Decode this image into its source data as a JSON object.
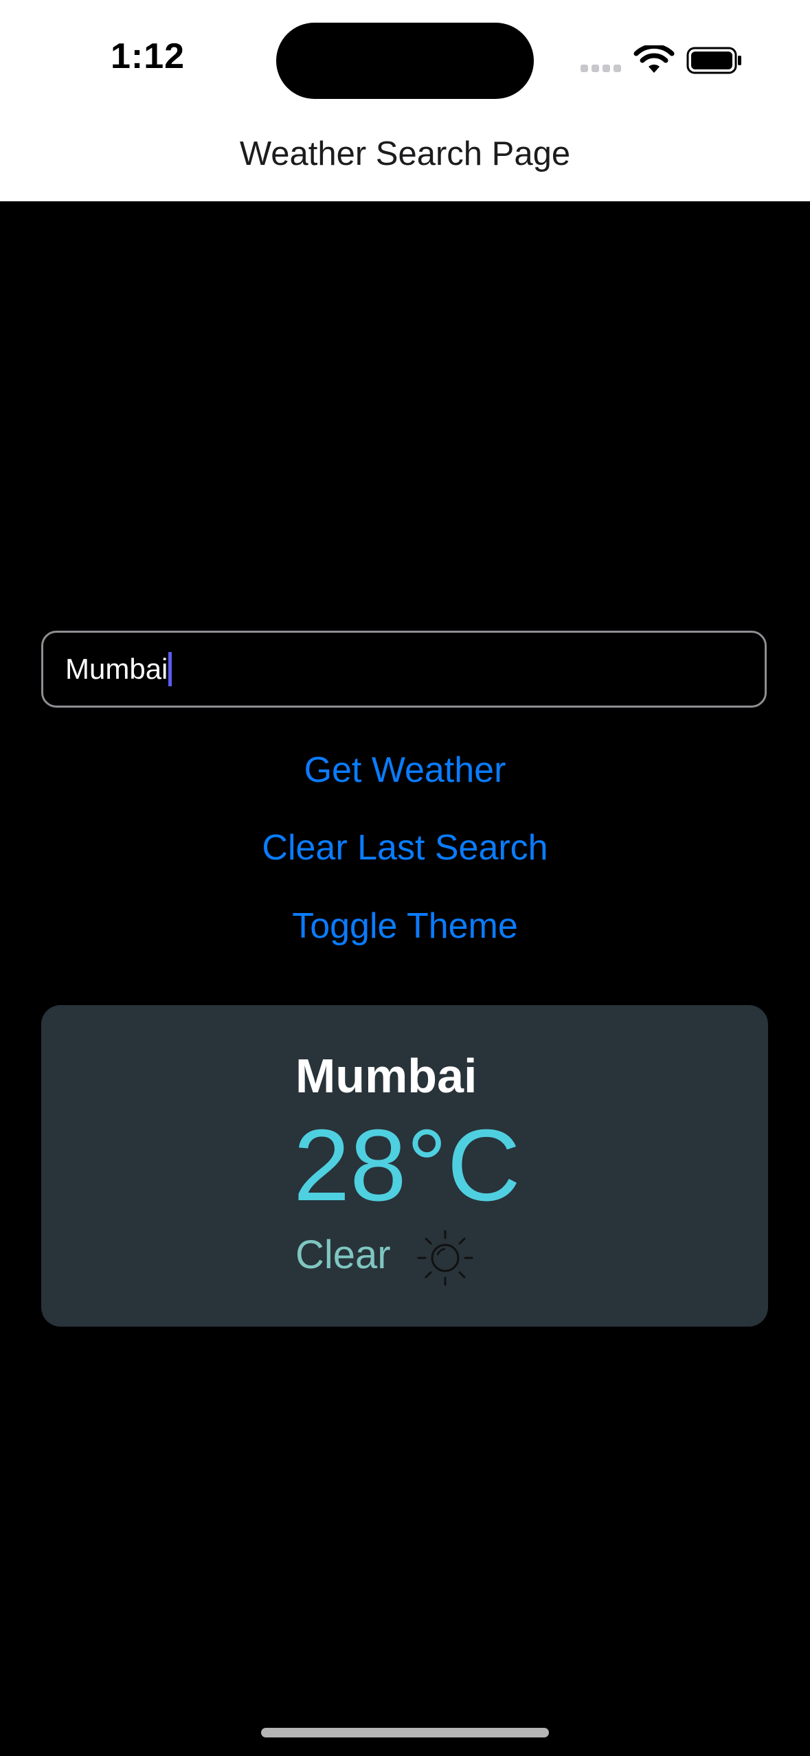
{
  "status_bar": {
    "time": "1:12"
  },
  "header": {
    "title": "Weather Search Page"
  },
  "search": {
    "value": "Mumbai",
    "placeholder": ""
  },
  "buttons": {
    "get_weather": "Get Weather",
    "clear_last_search": "Clear Last Search",
    "toggle_theme": "Toggle Theme"
  },
  "weather": {
    "city": "Mumbai",
    "temperature": "28°C",
    "condition": "Clear",
    "condition_icon": "sun-icon"
  },
  "colors": {
    "background": "#000000",
    "link": "#0a7cff",
    "card": "#29333a",
    "temperature": "#4fd0e0",
    "condition": "#7fc6c2"
  }
}
